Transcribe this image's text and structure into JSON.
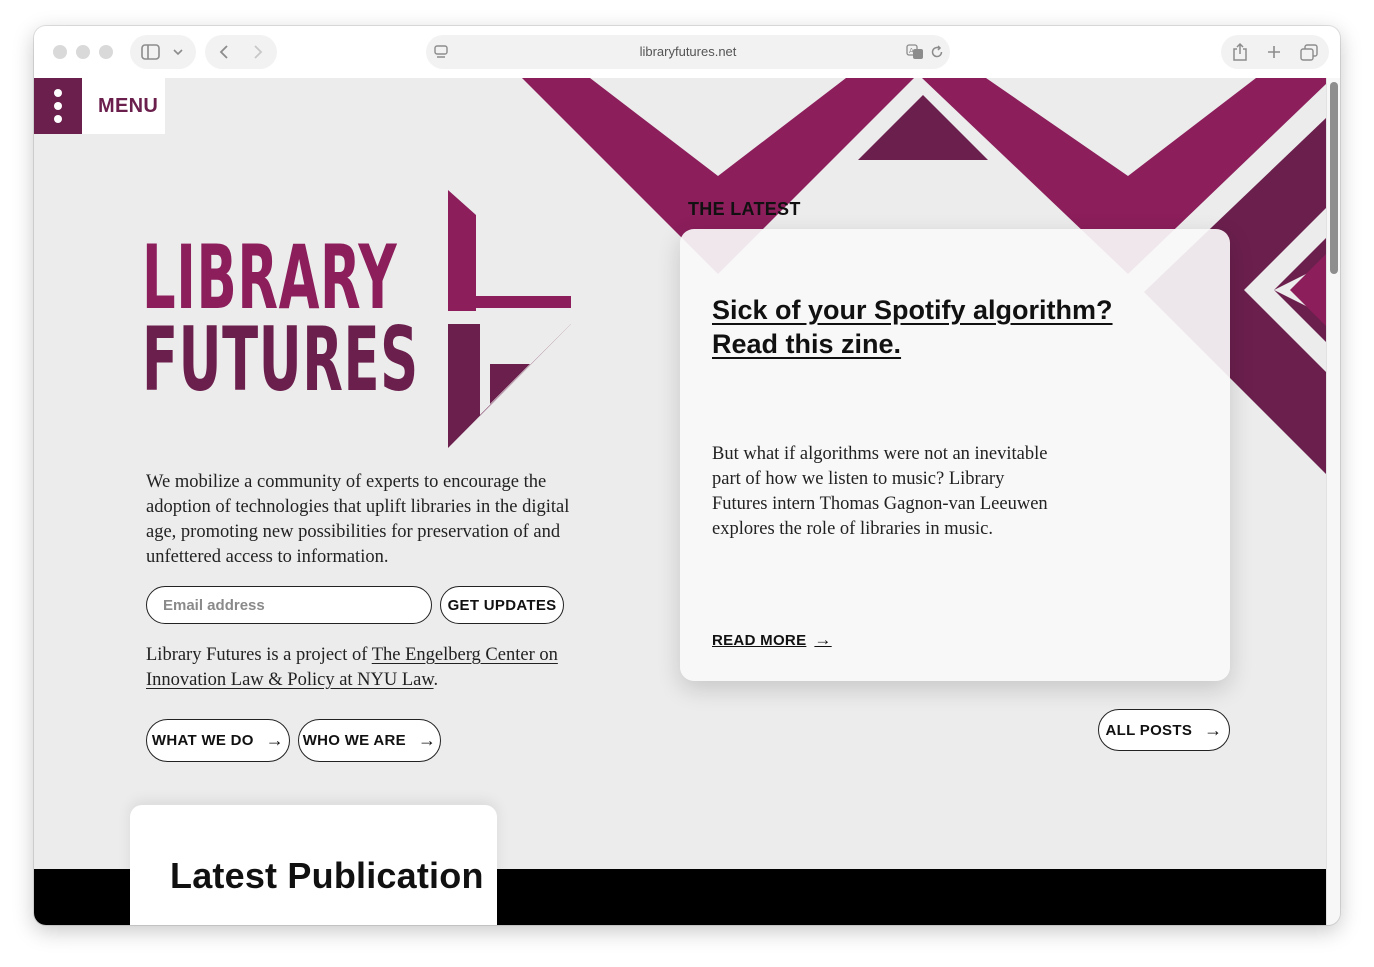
{
  "browser": {
    "url": "libraryfutures.net",
    "icons": {
      "sidebar": "sidebar-icon",
      "chevron": "chevron-down-icon",
      "back": "back-arrow-icon",
      "forward": "forward-arrow-icon",
      "page_menu": "page-menu-icon",
      "translate": "translate-icon",
      "reload": "reload-icon",
      "share": "share-icon",
      "new_tab": "plus-icon",
      "tabs": "tab-overview-icon"
    }
  },
  "nav": {
    "menu_label": "MENU"
  },
  "brand": {
    "line1": "LIBRARY",
    "line2": "FUTURES",
    "colors": {
      "primary": "#8b1e5b",
      "dark": "#6b1f4d"
    }
  },
  "hero": {
    "mission": "We mobilize a community of experts to encourage the adoption of technologies that uplift libraries in the digital age, promoting new possibilities for preservation of and unfettered access to information.",
    "email_placeholder": "Email address",
    "get_updates": "GET UPDATES",
    "project_prefix": "Library Futures is a project of ",
    "project_link": "The Engelberg Center on Innovation Law & Policy at NYU Law",
    "project_suffix": ".",
    "what_we_do": "WHAT WE DO",
    "who_we_are": "WHO WE ARE"
  },
  "latest": {
    "label": "THE LATEST",
    "title": "Sick of your Spotify algorithm? Read this zine.",
    "body": "But what if algorithms were not an inevitable part of how we listen to music? Library Futures intern Thomas Gagnon-van Leeuwen explores the role of libraries in music.",
    "read_more": "READ MORE",
    "all_posts": "ALL POSTS"
  },
  "publication": {
    "heading": "Latest Publication"
  }
}
